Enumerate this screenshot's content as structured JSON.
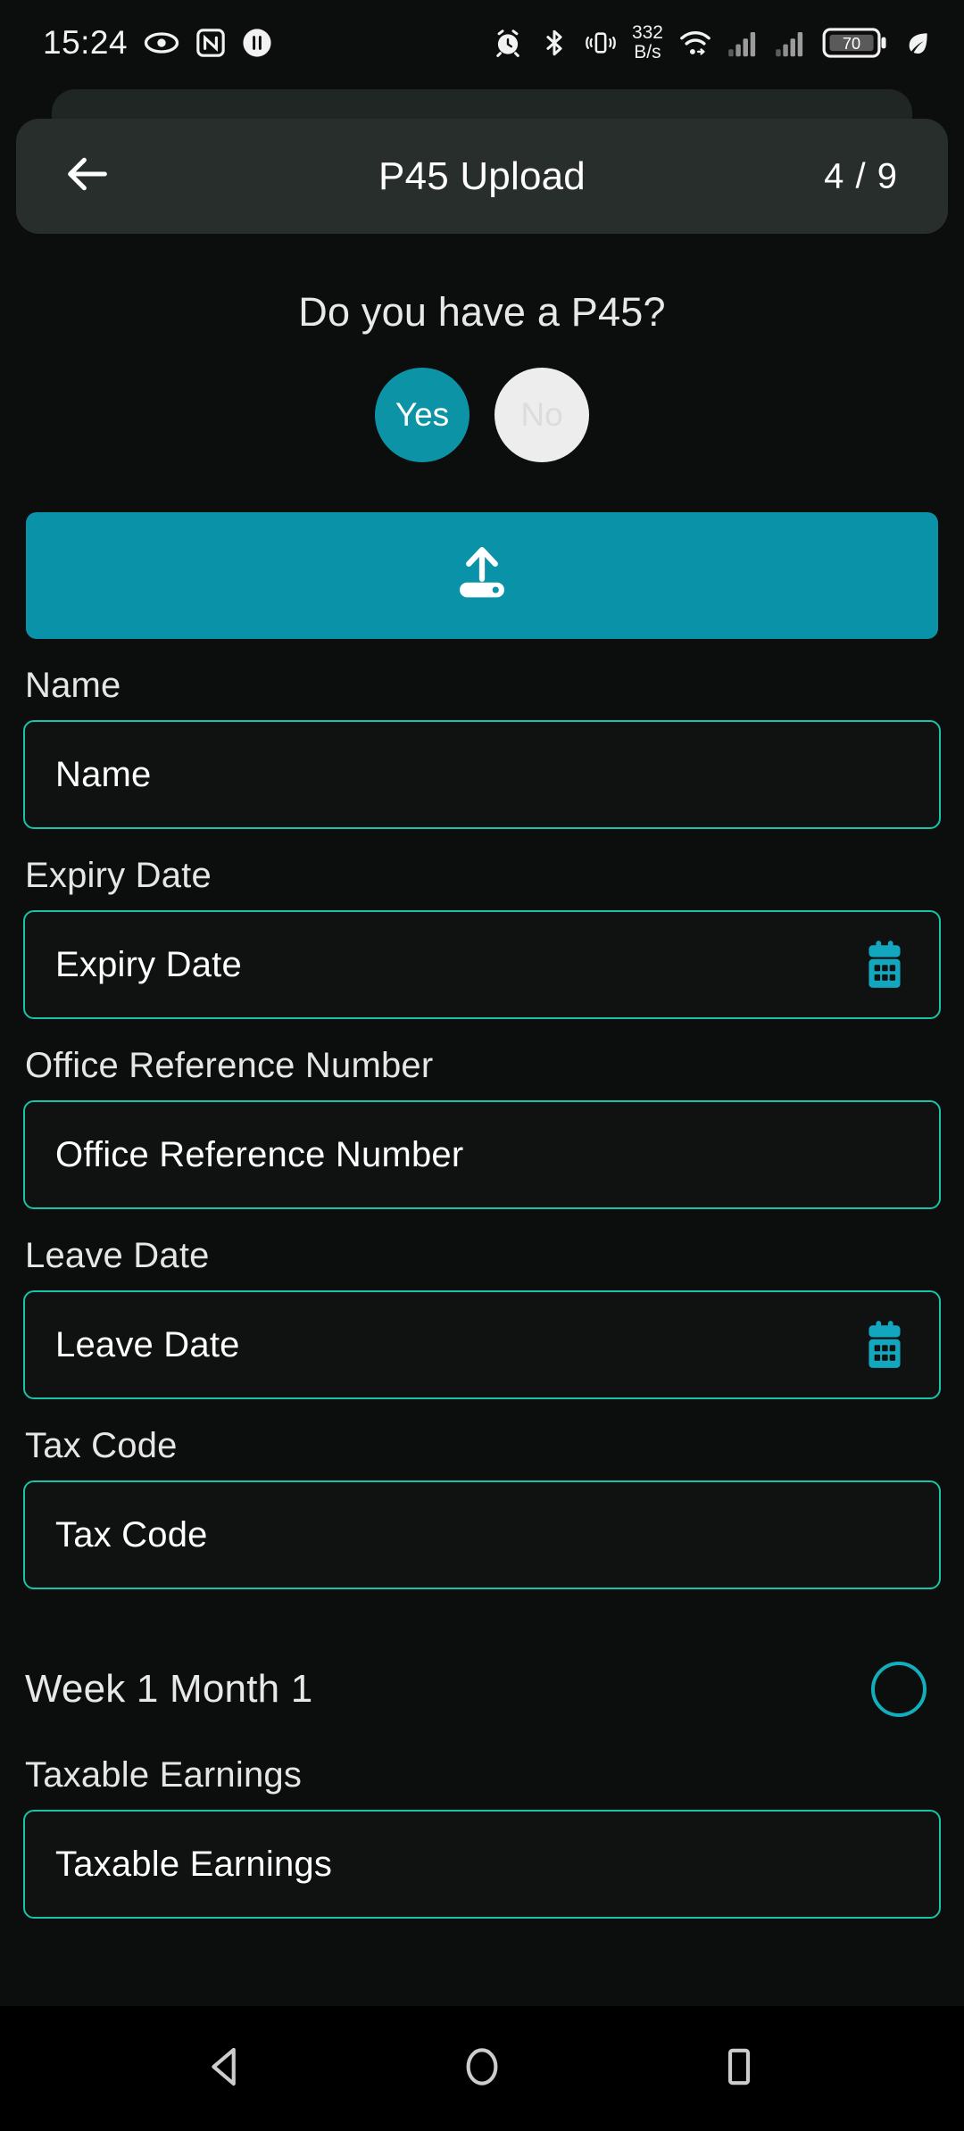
{
  "status_bar": {
    "time": "15:24",
    "left_icons": [
      "eye-icon",
      "nfc-icon",
      "data-transfer-icon"
    ],
    "network_speed": "332",
    "network_speed_unit": "B/s",
    "right_icons": [
      "alarm-icon",
      "bluetooth-icon",
      "vibrate-icon",
      "wifi-icon",
      "signal-bars-icon",
      "signal-bars-2-icon",
      "leaf-icon"
    ],
    "battery_level": "70"
  },
  "header": {
    "back_icon": "arrow-left-icon",
    "title": "P45 Upload",
    "step": "4 / 9"
  },
  "main": {
    "question": "Do you have a P45?",
    "choices": [
      {
        "label": "Yes",
        "selected": true
      },
      {
        "label": "No",
        "selected": false
      }
    ],
    "upload_button": {
      "icon": "upload-icon"
    },
    "fields": [
      {
        "label": "Name",
        "placeholder": "Name",
        "value": "",
        "icon": null
      },
      {
        "label": "Expiry Date",
        "placeholder": "Expiry Date",
        "value": "",
        "icon": "calendar-icon"
      },
      {
        "label": "Office Reference Number",
        "placeholder": "Office Reference Number",
        "value": "",
        "icon": null
      },
      {
        "label": "Leave Date",
        "placeholder": "Leave Date",
        "value": "",
        "icon": "calendar-icon"
      },
      {
        "label": "Tax Code",
        "placeholder": "Tax Code",
        "value": "",
        "icon": null
      }
    ],
    "toggle_row": {
      "label": "Week 1 Month 1",
      "checked": false,
      "icon": "radio-circle-icon"
    },
    "last_field": {
      "label": "Taxable Earnings",
      "placeholder": "Taxable Earnings",
      "value": ""
    }
  },
  "nav_bar": {
    "back": "triangle-back-icon",
    "home": "circle-home-icon",
    "recents": "square-recents-icon"
  },
  "colors": {
    "accent_teal": "#0a93a8",
    "field_border": "#18c3a7",
    "background": "#0c0d0d",
    "header_bar": "#272e2c",
    "header_back_card": "#1f2624",
    "choice_selected": "#0d93a6",
    "choice_unselected": "#ededed",
    "radio_outline": "#12aebc"
  }
}
